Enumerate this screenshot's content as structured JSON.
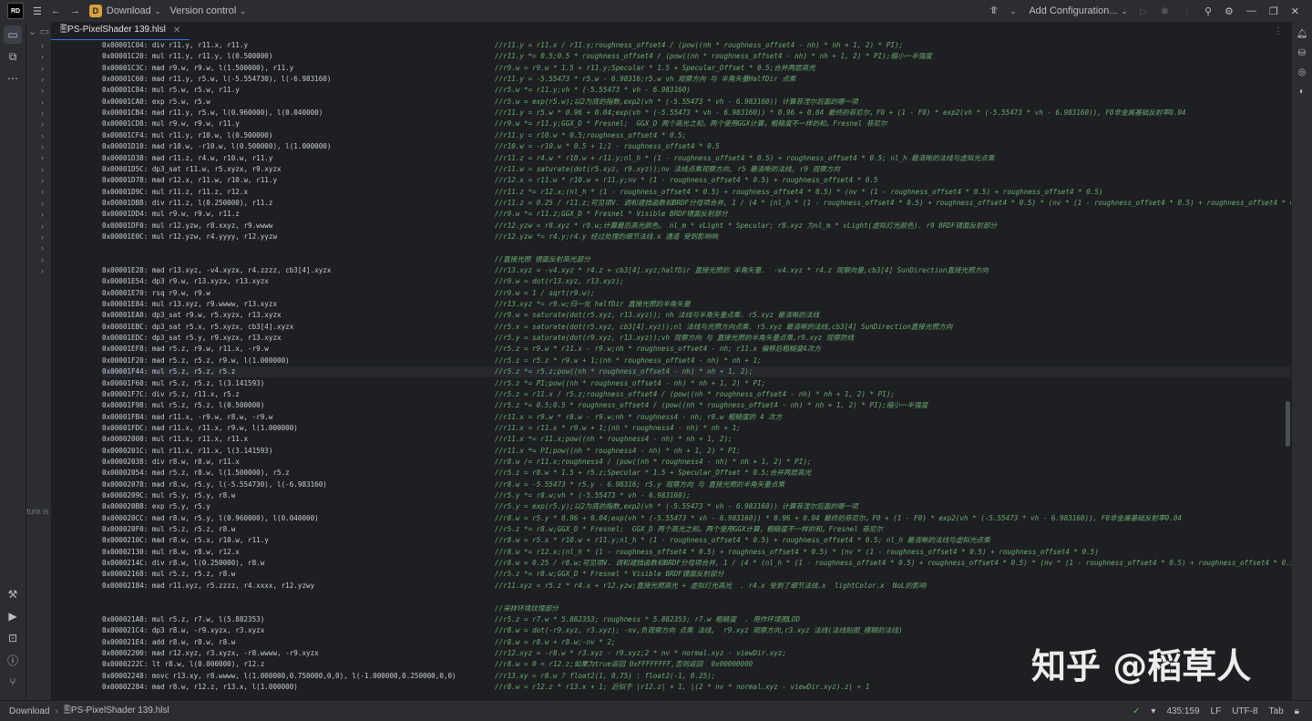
{
  "window": {
    "project_badge": "D",
    "project_name": "Download",
    "version_control": "Version control",
    "run_config": "Add Configuration..."
  },
  "tab": {
    "label": "🖺PS-PixelShader 139.hlsl"
  },
  "project_panel": {
    "hint": "ture is e"
  },
  "watermark": "知乎 @稻草人",
  "status": {
    "crumb_project": "Download",
    "crumb_file": "🖺PS-PixelShader 139.hlsl",
    "position": "435:159",
    "line_sep": "LF",
    "encoding": "UTF-8",
    "indent": "Tab"
  },
  "code_lines": [
    {
      "n": "406",
      "asm": "0x00001C04: div r11.y, r11.x, r11.y",
      "cmt": "//r11.y = r11.x / r11.y;roughness_offset4 / (pow((nh * roughness_offset4 - nh) * nh + 1, 2) * PI);"
    },
    {
      "n": "407",
      "asm": "0x00001C20: mul r11.y, r11.y, l(0.500000)",
      "cmt": "//r11.y *= 0.5;0.5 * roughness_offset4 / (pow((nh * roughness_offset4 - nh) * nh + 1, 2) * PI);缩小一半强度"
    },
    {
      "n": "408",
      "asm": "0x00001C3C: mad r9.w, r9.w, l(1.500000), r11.y",
      "cmt": "//r9.w = r9.w * 1.5 + r11.y;Specular * 1.5 + Specular_Offset * 0.5;合并两层高光"
    },
    {
      "n": "409",
      "asm": "0x00001C60: mad r11.y, r5.w, l(-5.554730), l(-6.983160)",
      "cmt": "//r11.y = -5.55473 * r5.w - 6.98316;r5.w vh 观察方向 与 半角矢量HalfDir 点乘"
    },
    {
      "n": "410",
      "asm": "0x00001C84: mul r5.w, r5.w, r11.y",
      "cmt": "//r5.w *= r11.y;vh * (-5.55473 * vh - 6.983160)"
    },
    {
      "n": "411",
      "asm": "0x00001CA0: exp r5.w, r5.w",
      "cmt": "//r5.w = exp(r5.w);以2为底的指数,exp2(vh * (-5.55473 * vh - 6.983160)) 计算菲涅尔后面的哪一项"
    },
    {
      "n": "412",
      "asm": "0x00001CB4: mad r11.y, r5.w, l(0.960000), l(0.040000)",
      "cmt": "//r11.y = r5.w * 0.96 + 0.04;exp(vh * (-5.55473 * vh - 6.983160)) * 0.96 + 0.04 最终的菲尼尔，F0 + (1 - F0) * exp2(vh * (-5.55473 * vh - 6.983160)), F0非金属基础反射率0.04"
    },
    {
      "n": "413",
      "asm": "0x00001CD8: mul r9.w, r9.w, r11.y",
      "cmt": "//r9.w *= r11.y;GGX_D * Fresnel;  GGX_D 两个高光之和。两个使用GGX计算，粗糙度不一样的和。Fresnel 菲尼尔"
    },
    {
      "n": "414",
      "asm": "0x00001CF4: mul r11.y, r10.w, l(0.500000)",
      "cmt": "//r11.y = r10.w * 0.5;roughness_offset4 * 0.5;"
    },
    {
      "n": "415",
      "asm": "0x00001D10: mad r10.w, -r10.w, l(0.500000), l(1.000000)",
      "cmt": "//r10.w = -r10.w * 0.5 + 1;1 - roughness_offset4 * 0.5"
    },
    {
      "n": "416",
      "asm": "0x00001D38: mad r11.z, r4.w, r10.w, r11.y",
      "cmt": "//r11.z = r4.w * r10.w + r11.y;nl_h * (1 - roughness_offset4 * 0.5) + roughness_offset4 * 0.5; nl_h 最清晰的法线与虚拟光点乘"
    },
    {
      "n": "417",
      "asm": "0x00001D5C: dp3_sat r11.w, r5.xyzx, r9.xyzx",
      "cmt": "//r11.w = saturate(dot(r5.xyz, r9.xyz));nv 法线点乘观察方向, r5 最清晰的法线, r9 观察方向"
    },
    {
      "n": "418",
      "asm": "0x00001D78: mad r12.x, r11.w, r10.w, r11.y",
      "cmt": "//r12.x = r11.w * r10.w + r11.y;nv * (1 - roughness_offset4 * 0.5) + roughness_offset4 * 0.5"
    },
    {
      "n": "419",
      "asm": "0x00001D9C: mul r11.z, r11.z, r12.x",
      "cmt": "//r11.z *= r12.x;(nl_h * (1 - roughness_offset4 * 0.5) + roughness_offset4 * 0.5) * (nv * (1 - roughness_offset4 * 0.5) + roughness_offset4 * 0.5)"
    },
    {
      "n": "420",
      "asm": "0x00001DB8: div r11.z, l(0.250000), r11.z",
      "cmt": "//r11.z = 0.25 / r11.z;可见项V. 调和遮挡函数和BRDF分母项合并, 1 / (4 * (nl_h * (1 - roughness_offset4 * 0.5) + roughness_offset4 * 0.5) * (nv * (1 - roughness_offset4 * 0.5) + roughness_offset4 * 0.5))"
    },
    {
      "n": "421",
      "asm": "0x00001DD4: mul r9.w, r9.w, r11.z",
      "cmt": "//r9.w *= r11.z;GGX_D * Fresnel * Visible BRDF镜面反射部分"
    },
    {
      "n": "422",
      "asm": "0x00001DF0: mul r12.yzw, r8.xxyz, r9.wwww",
      "cmt": "//r12.yzw = r8.xyz * r9.w;计算最后高光颜色。 nl_m * vLight * Specular; r8.xyz 为nl_m * vLight(虚拟灯光颜色). r9 BRDF镜面反射部分"
    },
    {
      "n": "423",
      "asm": "0x00001E0C: mul r12.yzw, r4.yyyy, r12.yyzw",
      "cmt": "//r12.yzw *= r4.y;r4.y 经过处理的细节法线.x 通道 受到影响响"
    },
    {
      "n": "424",
      "asm": "",
      "cmt": ""
    },
    {
      "n": "425",
      "asm": "",
      "cmt": "//直接光照 镜面反射高光部分"
    },
    {
      "n": "426",
      "asm": "0x00001E28: mad r13.xyz, -v4.xyzx, r4.zzzz, cb3[4].xyzx",
      "cmt": "//r13.xyz = -v4.xyz * r4.z + cb3[4].xyz;halfDir 直接光照的 半角矢量.  -v4.xyz * r4.z 观察向量,cb3[4] SunDirection直接光照方向"
    },
    {
      "n": "427",
      "asm": "0x00001E54: dp3 r9.w, r13.xyzx, r13.xyzx",
      "cmt": "//r9.w = dot(r13.xyz, r13.xyz);"
    },
    {
      "n": "428",
      "asm": "0x00001E70: rsq r9.w, r9.w",
      "cmt": "//r9.w = 1 / sqrt(r9.w);"
    },
    {
      "n": "429",
      "asm": "0x00001E84: mul r13.xyz, r9.wwww, r13.xyzx",
      "cmt": "//r13.xyz *= r9.w;归一化 halfDir 直接光照的半角矢量"
    },
    {
      "n": "430",
      "asm": "0x00001EA0: dp3_sat r9.w, r5.xyzx, r13.xyzx",
      "cmt": "//r9.w = saturate(dot(r5.xyz, r13.xyz)); nh 法线与半角矢量点乘. r5.xyz 最清晰的法线"
    },
    {
      "n": "431",
      "asm": "0x00001EBC: dp3_sat r5.x, r5.xyzx, cb3[4].xyzx",
      "cmt": "//r5.x = saturate(dot(r5.xyz, cb3[4].xyz));nl 法线与光照方向点乘. r5.xyz 最清晰的法线,cb3[4] SunDirection直接光照方向"
    },
    {
      "n": "432",
      "asm": "0x00001EDC: dp3_sat r5.y, r9.xyzx, r13.xyzx",
      "cmt": "//r5.y = saturate(dot(r9.xyz, r13.xyz));vh 观察方向 与 直接光照的半角矢量点乘,r9.xyz 观察防线"
    },
    {
      "n": "433",
      "asm": "0x00001EF8: mad r5.z, r9.w, r11.x, -r9.w",
      "cmt": "//r5.z = r9.w * r11.x - r9.w;nh * roughness_offset4 - nh; r11.x 偏移后粗糙度4次方"
    },
    {
      "n": "434",
      "asm": "0x00001F20: mad r5.z, r5.z, r9.w, l(1.000000)",
      "cmt": "//r5.z = r5.z * r9.w + 1;(nh * roughness_offset4 - nh) * nh + 1;"
    },
    {
      "n": "435",
      "asm": "0x00001F44: mul r5.z, r5.z, r5.z",
      "cmt": "//r5.z *= r5.z;pow((nh * roughness_offset4 - nh) * nh + 1, 2);"
    },
    {
      "n": "436",
      "asm": "0x00001F60: mul r5.z, r5.z, l(3.141593)",
      "cmt": "//r5.z *= PI;pow((nh * roughness_offset4 - nh) * nh + 1, 2) * PI;"
    },
    {
      "n": "437",
      "asm": "0x00001F7C: div r5.z, r11.x, r5.z",
      "cmt": "//r5.z = r11.x / r5.z;roughness_offset4 / (pow((nh * roughness_offset4 - nh) * nh + 1, 2) * PI);"
    },
    {
      "n": "438",
      "asm": "0x00001F98: mul r5.z, r5.z, l(0.500000)",
      "cmt": "//r5.z *= 0.5;0.5 * roughness_offset4 / (pow((nh * roughness_offset4 - nh) * nh + 1, 2) * PI);缩小一半强度"
    },
    {
      "n": "439",
      "asm": "0x00001FB4: mad r11.x, -r9.w, r8.w, -r9.w",
      "cmt": "//r11.x = r9.w * r8.w - r9.w;nh * roughness4 - nh; r8.w 粗糙度的 4 次方"
    },
    {
      "n": "440",
      "asm": "0x00001FDC: mad r11.x, r11.x, r9.w, l(1.000000)",
      "cmt": "//r11.x = r11.x * r9.w + 1;(nh * roughness4 - nh) * nh + 1;"
    },
    {
      "n": "441",
      "asm": "0x00002000: mul r11.x, r11.x, r11.x",
      "cmt": "//r11.x *= r11.x;pow((nh * roughness4 - nh) * nh + 1, 2);"
    },
    {
      "n": "442",
      "asm": "0x0000201C: mul r11.x, r11.x, l(3.141593)",
      "cmt": "//r11.x *= PI;pow((nh * roughness4 - nh) * nh + 1, 2) * PI;"
    },
    {
      "n": "443",
      "asm": "0x00002038: div r8.w, r8.w, r11.x",
      "cmt": "//r8.w /= r11.x;roughness4 / (pow((nh * roughness4 - nh) * nh + 1, 2) * PI);"
    },
    {
      "n": "444",
      "asm": "0x00002054: mad r5.z, r8.w, l(1.500000), r5.z",
      "cmt": "//r5.z = r8.w * 1.5 + r5.z;Specular * 1.5 + Specular_Offset * 0.5;合并两层高光"
    },
    {
      "n": "445",
      "asm": "0x00002078: mad r8.w, r5.y, l(-5.554730), l(-6.983160)",
      "cmt": "//r8.w = -5.55473 * r5.y - 6.98316; r5.y 观察方向 与 直接光照的半角矢量点乘"
    },
    {
      "n": "446",
      "asm": "0x0000209C: mul r5.y, r5.y, r8.w",
      "cmt": "//r5.y *= r8.w;vh * (-5.55473 * vh - 6.983160);"
    },
    {
      "n": "447",
      "asm": "0x000020B8: exp r5.y, r5.y",
      "cmt": "//r5.y = exp(r5.y);以2为底的指数,exp2(vh * (-5.55473 * vh - 6.983160)) 计算菲涅尔后面的哪一项"
    },
    {
      "n": "448",
      "asm": "0x000020CC: mad r8.w, r5.y, l(0.960000), l(0.040000)",
      "cmt": "//r8.w = r5.y * 0.96 + 0.04;exp(vh * (-5.55473 * vh - 6.983160)) * 0.96 + 0.04 最终的菲尼尔，F0 + (1 - F0) * exp2(vh * (-5.55473 * vh - 6.983160)), F0非金属基础反射率0.04"
    },
    {
      "n": "449",
      "asm": "0x000020F0: mul r5.z, r5.z, r8.w",
      "cmt": "//r5.z *= r8.w;GGX_D * Fresnel;  GGX_D 两个高光之和。两个使用GGX计算，粗糙度不一样的和。Fresnel 菲尼尔"
    },
    {
      "n": "450",
      "asm": "0x0000210C: mad r8.w, r5.x, r10.w, r11.y",
      "cmt": "//r8.w = r5.x * r10.w + r11.y;nl_h * (1 - roughness_offset4 * 0.5) + roughness_offset4 * 0.5; nl_h 最清晰的法线与虚拟光点乘"
    },
    {
      "n": "451",
      "asm": "0x00002130: mul r8.w, r8.w, r12.x",
      "cmt": "//r8.w *= r12.x;(nl_h * (1 - roughness_offset4 * 0.5) + roughness_offset4 * 0.5) * (nv * (1 - roughness_offset4 * 0.5) + roughness_offset4 * 0.5)"
    },
    {
      "n": "452",
      "asm": "0x0000214C: div r8.w, l(0.250000), r8.w",
      "cmt": "//r8.w = 0.25 / r8.w;可见项V. 调和遮挡函数和BRDF分母项合并, 1 / (4 * (nl_h * (1 - roughness_offset4 * 0.5) + roughness_offset4 * 0.5) * (nv * (1 - roughness_offset4 * 0.5) + roughness_offset4 * 0.5))"
    },
    {
      "n": "453",
      "asm": "0x00002168: mul r5.z, r5.z, r8.w",
      "cmt": "//r5.z *= r8.w;GGX_D * Fresnel * Visible BRDF镜面反射部分"
    },
    {
      "n": "454",
      "asm": "0x00002184: mad r11.xyz, r5.zzzz, r4.xxxx, r12.yzwy",
      "cmt": "//r11.xyz = r5.z * r4.x + r12.yzw;直接光照高光 + 虚拟灯光高光  . r4.x 受到了细节法线.x  lightColor.x  NoL的影响"
    },
    {
      "n": "455",
      "asm": "",
      "cmt": ""
    },
    {
      "n": "456",
      "asm": "",
      "cmt": "//采样环境纹理部分"
    },
    {
      "n": "457",
      "asm": "0x000021A8: mul r5.z, r7.w, l(5.882353)",
      "cmt": "//r5.z = r7.w * 5.882353; roughness * 5.882353; r7.w 粗糙度  . 用作环境图LOD"
    },
    {
      "n": "458",
      "asm": "0x000021C4: dp3 r8.w, -r9.xyzx, r3.xyzx",
      "cmt": "//r8.w = dot(-r9.xyz, r3.xyz); -nv,负观察方向 点乘 法线,  r9.xyz 观察方向,r3.xyz 法线(法线贴图_模糊的法线)"
    },
    {
      "n": "459",
      "asm": "0x000021E4: add r8.w, r8.w, r8.w",
      "cmt": "//r8.w = r8.w + r8.w;-nv * 2;"
    },
    {
      "n": "460",
      "asm": "0x00002200: mad r12.xyz, r3.xyzx, -r8.wwww, -r9.xyzx",
      "cmt": "//r12.xyz = -r8.w * r3.xyz - r9.xyz;2 * nv * normal.xyz - viewDir.xyz;"
    },
    {
      "n": "461",
      "asm": "0x0000222C: lt r8.w, l(0.000000), r12.z",
      "cmt": "//r8.w = 0 < r12.z;如果为true返回 0xFFFFFFFF,否则返回  0x00000000"
    },
    {
      "n": "462",
      "asm": "0x00002248: movc r13.xy, r8.wwww, l(1.000000,0.750000,0,0), l(-1.000000,0.250000,0,0)",
      "cmt": "//r13.xy = r8.w ? float2(1, 0.75) : float2(-1, 0.25);"
    },
    {
      "n": "463",
      "asm": "0x00002284: mad r8.w, r12.z, r13.x, l(1.000000)",
      "cmt": "//r8.w = r12.z * r13.x + 1; 近似于 |r12.z| + 1, |(2 * nv * normal.xyz - viewDir.xyz).z| + 1"
    }
  ]
}
